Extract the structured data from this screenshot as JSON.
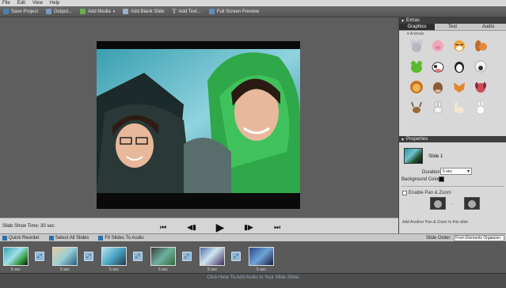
{
  "menu": [
    "File",
    "Edit",
    "View",
    "Help"
  ],
  "toolbar": {
    "save_project": "Save Project",
    "output": "Output...",
    "add_media": "Add Media",
    "add_blank_slide": "Add Blank Slide",
    "add_text": "Add Text...",
    "full_screen_preview": "Full Screen Preview"
  },
  "status": {
    "slide_show_time": "Slide Show Time: 30 sec"
  },
  "extras": {
    "title": "Extras",
    "tabs": [
      "Graphics",
      "Text",
      "Audio"
    ],
    "active_tab": "Graphics",
    "section": "Animals",
    "items": [
      "mouse",
      "pig",
      "tiger",
      "squirrel",
      "frog",
      "cow",
      "penguin",
      "sheep",
      "lion",
      "cow-head",
      "fox",
      "dog",
      "reindeer",
      "rabbit",
      "rabbit-white",
      "bunny"
    ]
  },
  "properties": {
    "title": "Properties",
    "slide_name": "Slide 1",
    "duration_label": "Duration:",
    "duration_value": "5 sec",
    "background_color_label": "Background Color:",
    "background_color": "#000000",
    "pan_zoom_label": "Enable Pan & Zoom",
    "pan_zoom_enabled": false,
    "add_pan_zoom": "Add Another Pan & Zoom to this slide"
  },
  "storybar": {
    "quick_reorder": "Quick Reorder",
    "select_all": "Select All Slides",
    "fit_slides": "Fit Slides To Audio",
    "slide_order_label": "Slide Order:",
    "slide_order_value": "From Elements Organizer"
  },
  "filmstrip": {
    "slides": [
      {
        "duration": "5 sec"
      },
      {
        "duration": "5 sec"
      },
      {
        "duration": "5 sec"
      },
      {
        "duration": "5 sec"
      },
      {
        "duration": "5 sec"
      },
      {
        "duration": "5 sec"
      }
    ]
  },
  "footer": {
    "add_audio": "Click Here To Add Audio to Your Slide Show"
  }
}
